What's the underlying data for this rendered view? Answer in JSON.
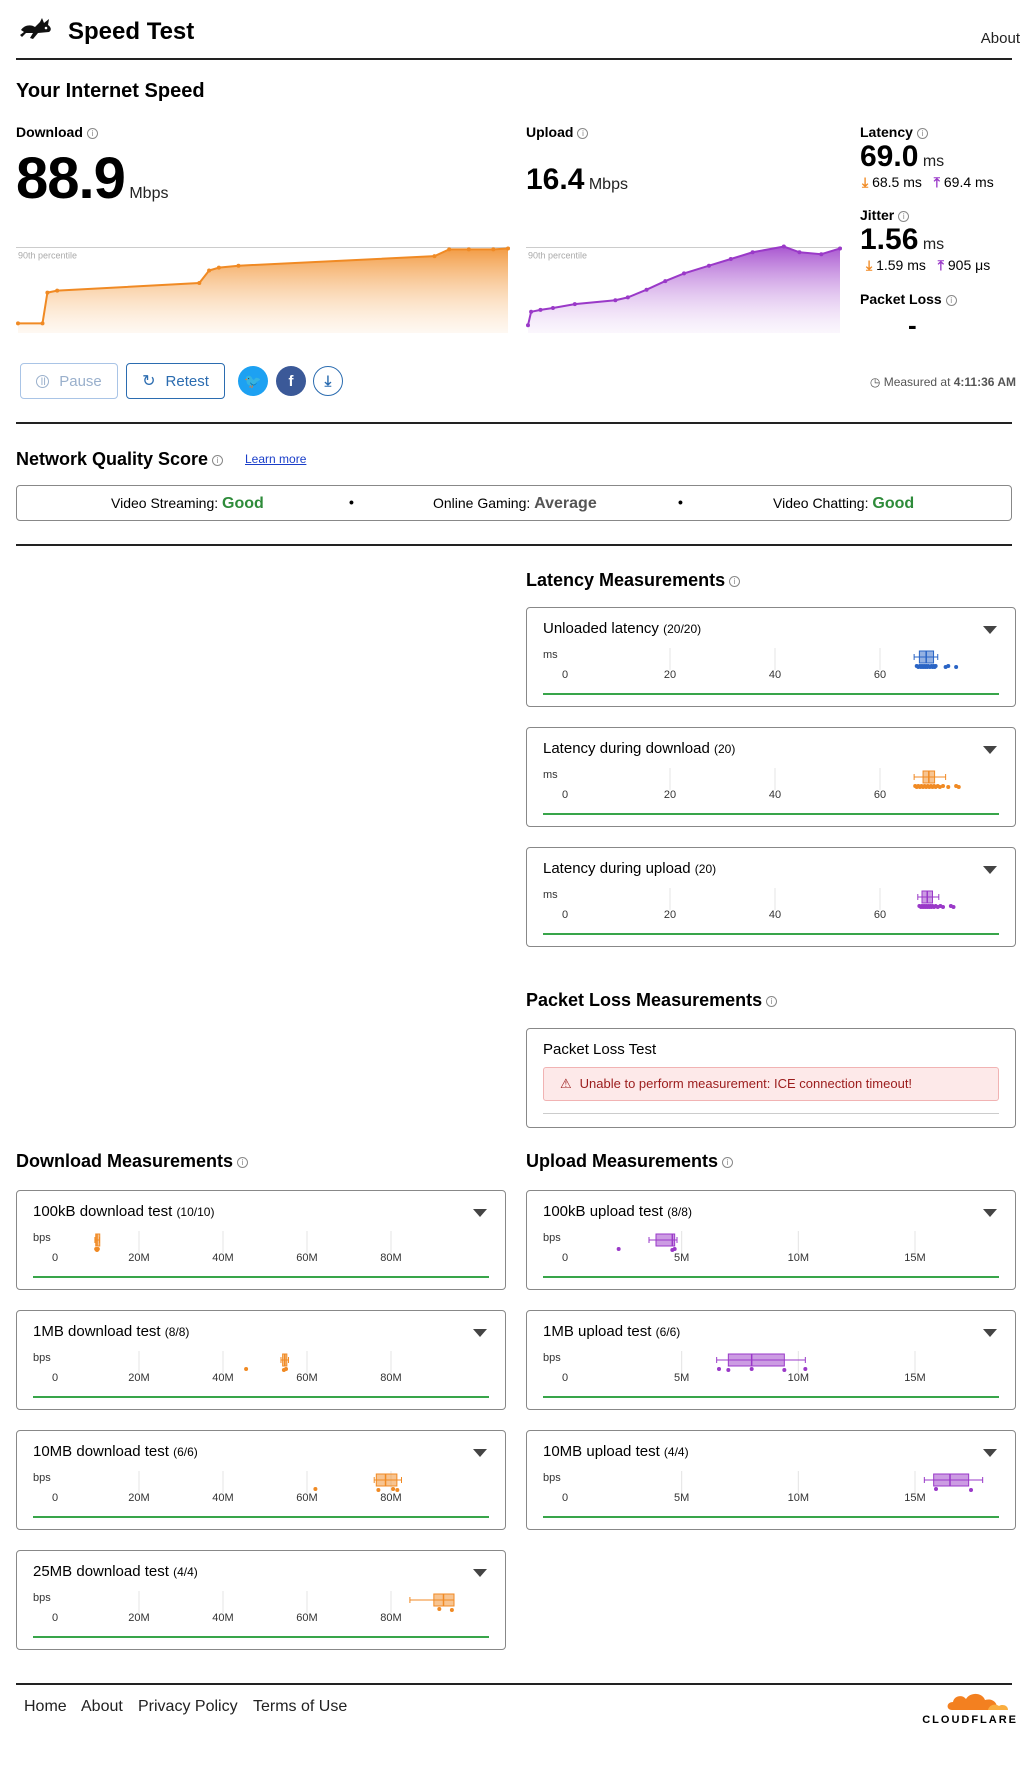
{
  "header": {
    "title": "Speed Test",
    "about": "About",
    "brand_icon": "rabbit-icon"
  },
  "summary": {
    "heading": "Your Internet Speed",
    "download": {
      "label": "Download",
      "value": "88.9",
      "unit": "Mbps",
      "percentile": "90th percentile",
      "series": [
        [
          0,
          8
        ],
        [
          5,
          8
        ],
        [
          6,
          40
        ],
        [
          8,
          42
        ],
        [
          37,
          50
        ],
        [
          39,
          63
        ],
        [
          41,
          66
        ],
        [
          45,
          68
        ],
        [
          85,
          78
        ],
        [
          88,
          85
        ],
        [
          92,
          85
        ],
        [
          97,
          85
        ],
        [
          100,
          86
        ]
      ]
    },
    "upload": {
      "label": "Upload",
      "value": "16.4",
      "unit": "Mbps",
      "percentile": "90th percentile",
      "series": [
        [
          0,
          6
        ],
        [
          1,
          20
        ],
        [
          4,
          22
        ],
        [
          8,
          24
        ],
        [
          15,
          28
        ],
        [
          28,
          32
        ],
        [
          32,
          35
        ],
        [
          38,
          43
        ],
        [
          44,
          52
        ],
        [
          50,
          60
        ],
        [
          58,
          68
        ],
        [
          65,
          75
        ],
        [
          72,
          82
        ],
        [
          82,
          88
        ],
        [
          87,
          82
        ],
        [
          94,
          80
        ],
        [
          100,
          86
        ]
      ]
    },
    "latency": {
      "label": "Latency",
      "value": "69.0",
      "unit": "ms",
      "down": "68.5 ms",
      "up": "69.4 ms"
    },
    "jitter": {
      "label": "Jitter",
      "value": "1.56",
      "unit": "ms",
      "down": "1.59 ms",
      "up": "905 μs"
    },
    "packet_loss": {
      "label": "Packet Loss",
      "value": "-"
    },
    "buttons": {
      "pause": "Pause",
      "retest": "Retest"
    },
    "measured_prefix": "Measured at",
    "measured_time": "4:11:36 AM"
  },
  "quality": {
    "heading": "Network Quality Score",
    "learn_more": "Learn more",
    "items": [
      {
        "label": "Video Streaming:",
        "value": "Good"
      },
      {
        "label": "Online Gaming:",
        "value": "Average"
      },
      {
        "label": "Video Chatting:",
        "value": "Good"
      }
    ]
  },
  "latency_section": {
    "heading": "Latency Measurements",
    "cards": [
      {
        "title": "Unloaded latency",
        "count": "(20/20)",
        "unit": "ms",
        "color": "#2a64c5",
        "ticks": [
          "0",
          "20",
          "40",
          "60"
        ],
        "max": 80,
        "box": [
          67.5,
          68.8,
          70.2
        ],
        "whisker": [
          66.5,
          71.0
        ],
        "points": [
          67,
          67.3,
          67.6,
          67.8,
          68,
          68.2,
          68.4,
          68.6,
          68.8,
          69,
          69.2,
          69.5,
          69.8,
          70,
          70.2,
          70.4,
          70.6,
          72.5,
          73,
          74.5
        ]
      },
      {
        "title": "Latency during download",
        "count": "(20)",
        "unit": "ms",
        "color": "#f08a24",
        "ticks": [
          "0",
          "20",
          "40",
          "60"
        ],
        "max": 80,
        "box": [
          68.2,
          69.3,
          70.4
        ],
        "whisker": [
          66.5,
          72.5
        ],
        "points": [
          66.7,
          67,
          67.3,
          67.6,
          67.9,
          68.2,
          68.5,
          68.8,
          69.1,
          69.4,
          69.7,
          70,
          70.3,
          70.6,
          71,
          71.4,
          72,
          73,
          74.5,
          75
        ]
      },
      {
        "title": "Latency during upload",
        "count": "(20)",
        "unit": "ms",
        "color": "#9a39c8",
        "ticks": [
          "0",
          "20",
          "40",
          "60"
        ],
        "max": 80,
        "box": [
          68.0,
          69.0,
          70.0
        ],
        "whisker": [
          67.2,
          71.2
        ],
        "points": [
          67.5,
          67.8,
          68,
          68.2,
          68.4,
          68.6,
          68.8,
          69,
          69.2,
          69.4,
          69.6,
          69.8,
          70,
          70.3,
          70.6,
          71,
          71.5,
          72,
          73.5,
          74
        ]
      }
    ]
  },
  "packet_loss_section": {
    "heading": "Packet Loss Measurements",
    "card_title": "Packet Loss Test",
    "error": "Unable to perform measurement: ICE connection timeout!"
  },
  "download_section": {
    "heading": "Download Measurements",
    "cards": [
      {
        "title": "100kB download test",
        "count": "(10/10)",
        "unit": "bps",
        "color": "#f08a24",
        "ticks": [
          "0",
          "20M",
          "40M",
          "60M",
          "80M"
        ],
        "max": 100,
        "box": [
          9.7,
          10.0,
          10.4
        ],
        "whisker": [
          9.5,
          10.6
        ],
        "points": [
          9.8,
          10,
          10.2
        ]
      },
      {
        "title": "1MB download test",
        "count": "(8/8)",
        "unit": "bps",
        "color": "#f08a24",
        "ticks": [
          "0",
          "20M",
          "40M",
          "60M",
          "80M"
        ],
        "max": 100,
        "box": [
          54.2,
          54.7,
          55.2
        ],
        "whisker": [
          53.8,
          55.6
        ],
        "points": [
          45.5,
          54.5,
          55
        ]
      },
      {
        "title": "10MB download test",
        "count": "(6/6)",
        "unit": "bps",
        "color": "#f08a24",
        "ticks": [
          "0",
          "20M",
          "40M",
          "60M",
          "80M"
        ],
        "max": 100,
        "box": [
          76.5,
          78.7,
          81.4
        ],
        "whisker": [
          76.0,
          82.5
        ],
        "points": [
          62,
          77,
          80.5,
          81.5
        ]
      },
      {
        "title": "25MB download test",
        "count": "(4/4)",
        "unit": "bps",
        "color": "#f08a24",
        "ticks": [
          "0",
          "20M",
          "40M",
          "60M",
          "80M"
        ],
        "max": 100,
        "box": [
          90.2,
          92.5,
          95.0
        ],
        "whisker": [
          84.5,
          95.0
        ],
        "points": [
          91.5,
          94.5
        ]
      }
    ]
  },
  "upload_section": {
    "heading": "Upload Measurements",
    "cards": [
      {
        "title": "100kB upload test",
        "count": "(8/8)",
        "unit": "bps",
        "color": "#9a39c8",
        "ticks": [
          "0",
          "5M",
          "10M",
          "15M"
        ],
        "max": 18,
        "box": [
          3.9,
          4.6,
          4.7
        ],
        "whisker": [
          3.6,
          4.8
        ],
        "points": [
          2.3,
          4.6,
          4.7
        ]
      },
      {
        "title": "1MB upload test",
        "count": "(6/6)",
        "unit": "bps",
        "color": "#9a39c8",
        "ticks": [
          "0",
          "5M",
          "10M",
          "15M"
        ],
        "max": 18,
        "box": [
          7.0,
          8.0,
          9.4
        ],
        "whisker": [
          6.5,
          10.3
        ],
        "points": [
          6.6,
          7,
          8,
          9.4,
          10.3
        ]
      },
      {
        "title": "10MB upload test",
        "count": "(4/4)",
        "unit": "bps",
        "color": "#9a39c8",
        "ticks": [
          "0",
          "5M",
          "10M",
          "15M"
        ],
        "max": 18,
        "box": [
          15.8,
          16.5,
          17.3
        ],
        "whisker": [
          15.4,
          17.9
        ],
        "points": [
          15.9,
          17.4
        ]
      }
    ]
  },
  "footer": {
    "links": [
      "Home",
      "About",
      "Privacy Policy",
      "Terms of Use"
    ],
    "brand": "CLOUDFLARE"
  }
}
